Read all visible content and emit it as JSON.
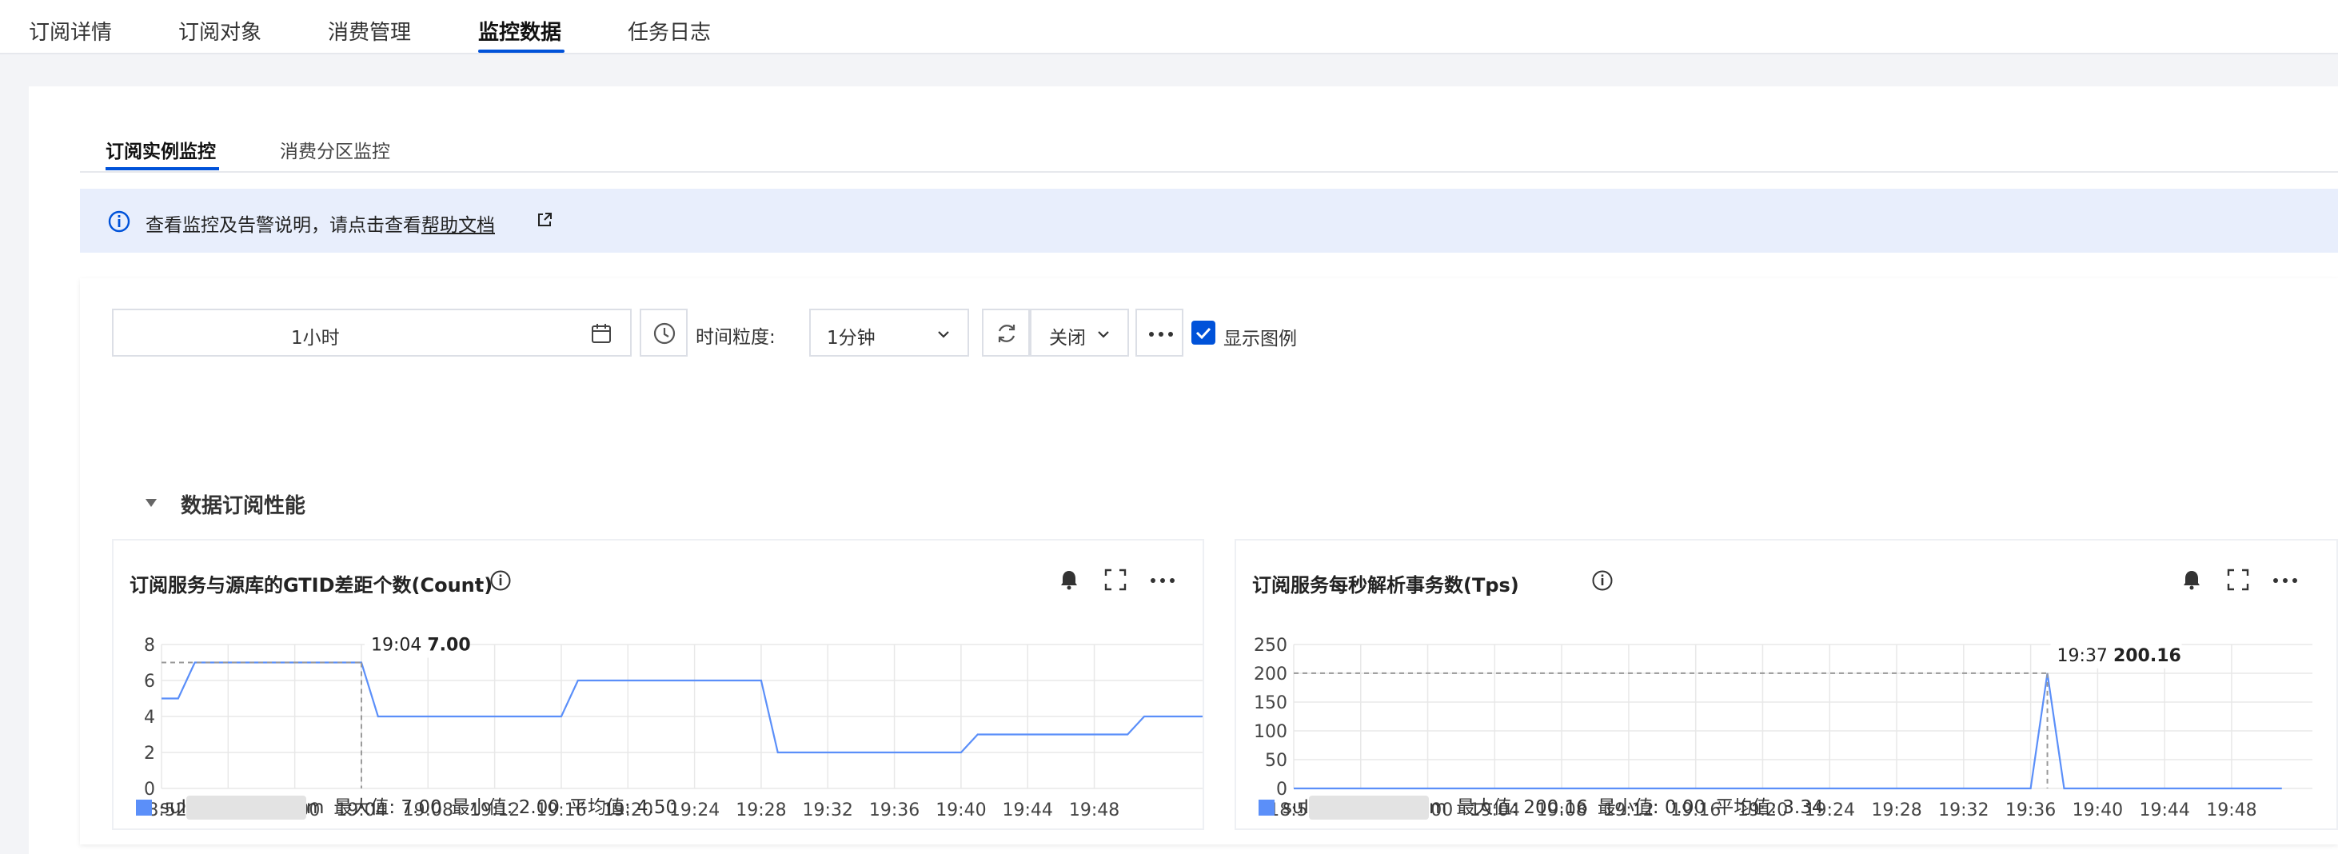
{
  "top_tabs": [
    {
      "label": "订阅详情"
    },
    {
      "label": "订阅对象"
    },
    {
      "label": "消费管理"
    },
    {
      "label": "监控数据"
    },
    {
      "label": "任务日志"
    }
  ],
  "sub_tabs": [
    {
      "label": "订阅实例监控"
    },
    {
      "label": "消费分区监控"
    }
  ],
  "notice": {
    "text": "查看监控及告警说明，请点击查看",
    "link": "帮助文档"
  },
  "toolbar": {
    "time_range": "1小时",
    "granularity_label": "时间粒度:",
    "granularity_value": "1分钟",
    "refresh_value": "关闭",
    "show_legend_label": "显示图例",
    "show_legend_checked": true
  },
  "section": {
    "title": "数据订阅性能"
  },
  "colors": {
    "accent": "#0052d9",
    "series": "#5b8ff9",
    "grid": "#e8e8e8"
  },
  "charts": [
    {
      "title": "订阅服务与源库的GTID差距个数(Count)",
      "legend": {
        "prefix": "sul",
        "suffix": "m",
        "max": "最大值: 7.00",
        "min": "最小值: 2.00",
        "avg": "平均值: 4.50"
      },
      "tooltip": {
        "time": "19:04",
        "value": "7.00"
      }
    },
    {
      "title": "订阅服务每秒解析事务数(Tps)",
      "legend": {
        "prefix": "sul",
        "suffix": "m",
        "max": "最大值: 200.16",
        "min": "最小值: 0.00",
        "avg": "平均值: 3.34"
      },
      "tooltip": {
        "time": "19:37",
        "value": "200.16"
      }
    }
  ],
  "chart_data": [
    {
      "type": "line",
      "title": "订阅服务与源库的GTID差距个数(Count)",
      "x_ticks": [
        "18:52",
        "18:56",
        "19:00",
        "19:04",
        "19:08",
        "19:12",
        "19:16",
        "19:20",
        "19:24",
        "19:28",
        "19:32",
        "19:36",
        "19:40",
        "19:44",
        "19:48"
      ],
      "y_ticks": [
        0,
        2,
        4,
        6,
        8
      ],
      "ylim": [
        0,
        8
      ],
      "x_range_min": [
        0,
        61
      ],
      "grid": true,
      "series": [
        {
          "name": "",
          "x_min": [
            0,
            1,
            2,
            12,
            13,
            24,
            25,
            36,
            37,
            48,
            49,
            58,
            59,
            64,
            65
          ],
          "values": [
            5,
            5,
            7,
            7,
            4,
            4,
            6,
            6,
            2,
            2,
            3,
            3,
            4,
            4,
            4
          ]
        }
      ]
    },
    {
      "type": "line",
      "title": "订阅服务每秒解析事务数(Tps)",
      "x_ticks": [
        "18:52",
        "18:56",
        "19:00",
        "19:04",
        "19:08",
        "19:12",
        "19:16",
        "19:20",
        "19:24",
        "19:28",
        "19:32",
        "19:36",
        "19:40",
        "19:44",
        "19:48"
      ],
      "y_ticks": [
        0,
        50,
        100,
        150,
        200,
        250
      ],
      "ylim": [
        0,
        250
      ],
      "x_range_min": [
        0,
        59
      ],
      "grid": true,
      "series": [
        {
          "name": "",
          "x_min": [
            0,
            44,
            45,
            46,
            59
          ],
          "values": [
            0,
            0,
            200.16,
            0,
            0
          ]
        }
      ]
    }
  ]
}
